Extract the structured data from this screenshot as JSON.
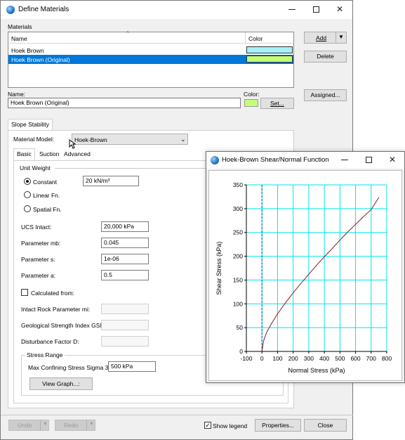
{
  "main_window": {
    "title": "Define Materials",
    "materials_label": "Materials",
    "columns": [
      "Name",
      "Color"
    ],
    "sort_indicator": "^",
    "materials": [
      {
        "name": "Hoek Brown",
        "color": "#a6f2fb",
        "selected": false
      },
      {
        "name": "Hoek Brown (Original)",
        "color": "#c2ff79",
        "selected": true
      }
    ],
    "add_label": "Add",
    "delete_label": "Delete",
    "name_label": "Name:",
    "name_value": "Hoek Brown (Original)",
    "color_label": "Color:",
    "current_color": "#c2ff79",
    "set_label": "Set...",
    "assigned_label": "Assigned...",
    "group_tab": "Slope Stability",
    "material_model_label": "Material Model:",
    "material_model_value": "Hoek-Brown",
    "tabs": [
      "Basic",
      "Suction",
      "Advanced"
    ],
    "unit_weight_label": "Unit Weight",
    "radio_constant": "Constant",
    "constant_value": "20 kN/m³",
    "radio_linear": "Linear Fn.",
    "radio_spatial": "Spatial Fn.",
    "ucs_label": "UCS Intact:",
    "ucs_value": "20,000 kPa",
    "mb_label": "Parameter mb:",
    "mb_value": "0.045",
    "s_label": "Parameter s:",
    "s_value": "1e-06",
    "a_label": "Parameter a:",
    "a_value": "0.5",
    "calculated_label": "Calculated from:",
    "mi_label": "Intact Rock Parameter mi:",
    "gsi_label": "Geological Strength Index GSI:",
    "d_label": "Disturbance Factor D:",
    "stress_range_label": "Stress Range",
    "sigma3_label": "Max Confining Stress Sigma 3:",
    "sigma3_value": "500 kPa",
    "view_graph_label": "View Graph...:",
    "undo_label": "Undo",
    "redo_label": "Redo",
    "show_legend_label": "Show legend",
    "properties_label": "Properties...",
    "close_label": "Close"
  },
  "graph_window": {
    "title": "Hoek-Brown Shear/Normal Function"
  },
  "chart_data": {
    "type": "line",
    "title": "",
    "xlabel": "Normal Stress (kPa)",
    "ylabel": "Shear Stress (kPa)",
    "xlim": [
      -100,
      800
    ],
    "ylim": [
      0,
      350
    ],
    "xticks": [
      -100,
      0,
      100,
      200,
      300,
      400,
      500,
      600,
      700,
      800
    ],
    "yticks": [
      0,
      50,
      100,
      150,
      200,
      250,
      300,
      350
    ],
    "grid": true,
    "grid_color": "#00e5ee",
    "line_color": "#8b1a1a",
    "reference_line": {
      "x": 0,
      "style": "dashed",
      "color": "#1f4e9a"
    },
    "series": [
      {
        "x": [
          0,
          10,
          30,
          60,
          100,
          150,
          200,
          250,
          300,
          350,
          400,
          450,
          500,
          550,
          600,
          650,
          700,
          750
        ],
        "y": [
          0,
          22,
          40,
          58,
          79,
          102,
          123,
          143,
          162,
          181,
          199,
          216,
          234,
          251,
          267,
          283,
          298,
          324
        ]
      }
    ]
  }
}
